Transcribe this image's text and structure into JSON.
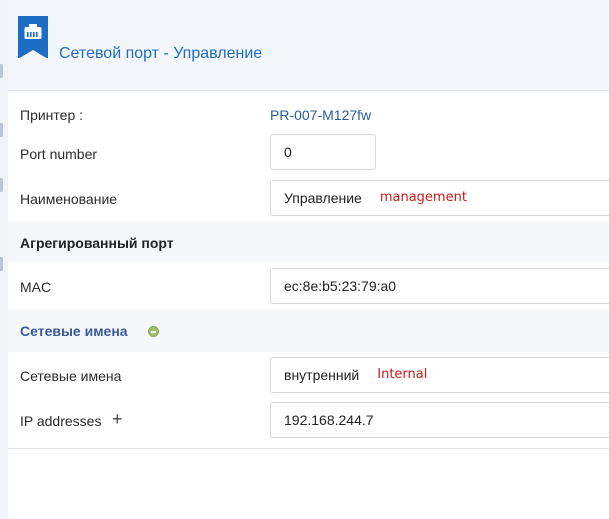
{
  "header": {
    "title": "Сетевой порт - Управление",
    "icon": "network-port-icon",
    "accent": "#1f6cc4"
  },
  "fields": {
    "printer_label": "Принтер :",
    "printer_value": "PR-007-M127fw",
    "port_number_label": "Port number",
    "port_number_value": "0",
    "name_label": "Наименование",
    "name_value": "Управление",
    "name_annotation": "management"
  },
  "aggregated_section": {
    "title": "Агрегированный порт",
    "mac_label": "MAC",
    "mac_value": "ec:8e:b5:23:79:a0"
  },
  "network_names_section": {
    "title": "Сетевые имена",
    "network_names_label": "Сетевые имена",
    "network_names_value": "внутренний",
    "network_names_annotation": "Internal",
    "ip_label": "IP addresses",
    "ip_add_icon": "plus-icon",
    "ip_value": "192.168.244.7"
  },
  "colors": {
    "annotation": "#cc1a1a",
    "link": "#2b5c99",
    "section_blue": "#3a5a9b"
  }
}
